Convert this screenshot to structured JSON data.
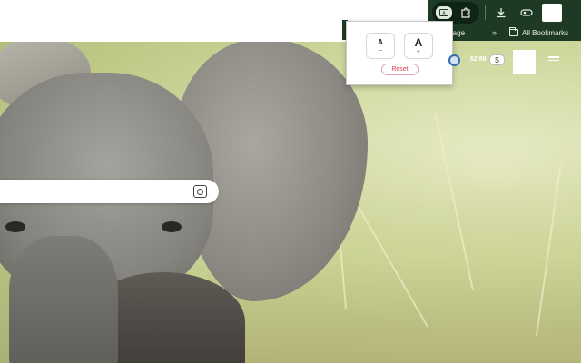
{
  "bookmarks_bar": {
    "partial_text": "rage",
    "overflow": "»",
    "folder_label": "All Bookmarks"
  },
  "popup": {
    "small_glyph": "A",
    "small_sign": "–",
    "large_glyph": "A",
    "large_sign": "+",
    "reset_label": "Reset"
  },
  "overlay": {
    "price": "$2.89",
    "currency_button": "$"
  },
  "colors": {
    "toolbar_bg": "#1e3a24",
    "reset_text": "#d23f52",
    "reset_border": "#e3a6ad"
  },
  "icons": [
    "extension-active-icon",
    "puzzle-icon",
    "download-icon",
    "password-key-icon",
    "shield-icon",
    "menu-icon",
    "lens-icon",
    "folder-icon"
  ]
}
